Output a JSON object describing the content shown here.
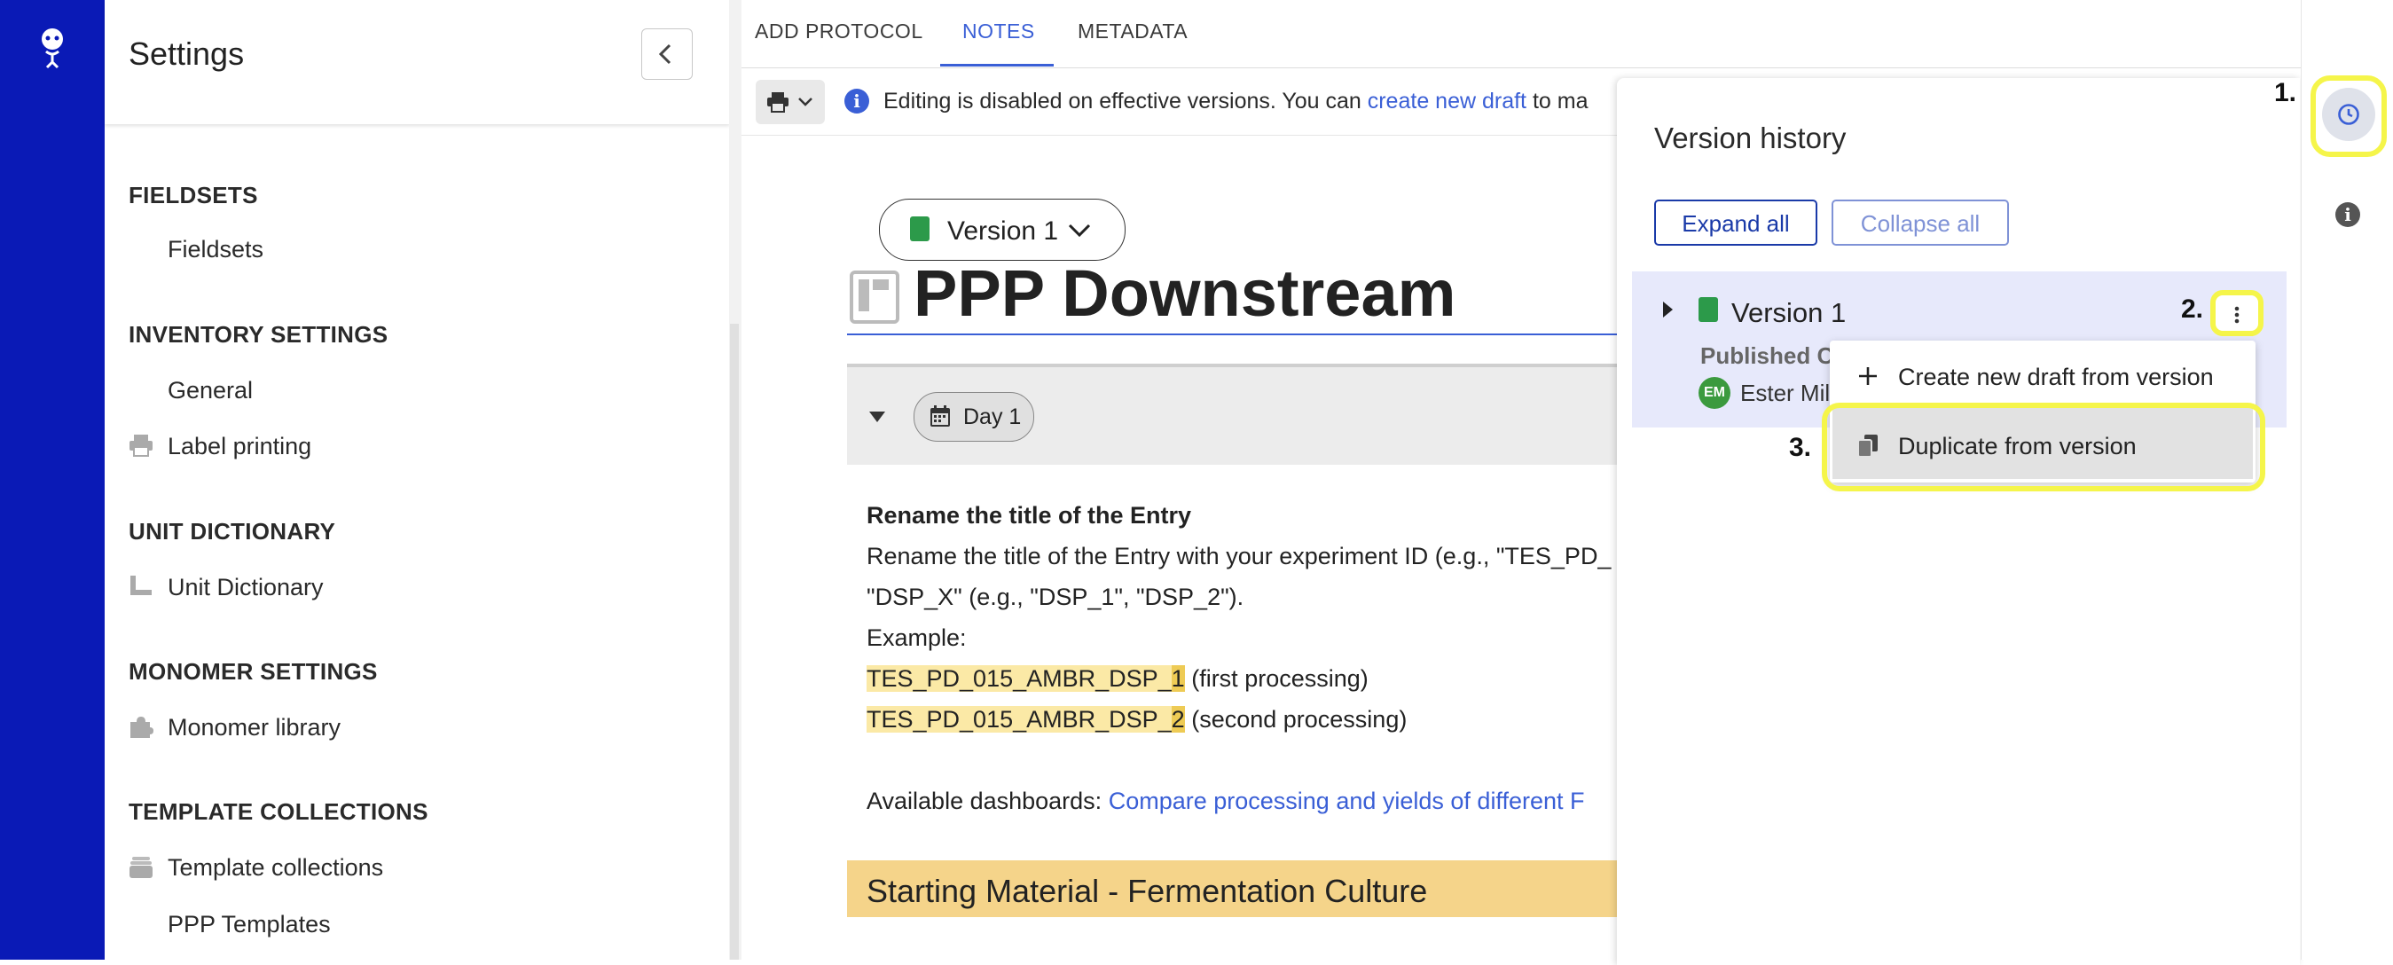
{
  "settings": {
    "title": "Settings",
    "sections": [
      {
        "heading": "FIELDSETS",
        "items": [
          {
            "label": "Fieldsets",
            "icon": null
          }
        ]
      },
      {
        "heading": "INVENTORY SETTINGS",
        "items": [
          {
            "label": "General",
            "icon": null
          },
          {
            "label": "Label printing",
            "icon": "printer-icon"
          }
        ]
      },
      {
        "heading": "UNIT DICTIONARY",
        "items": [
          {
            "label": "Unit Dictionary",
            "icon": "ruler-icon"
          }
        ]
      },
      {
        "heading": "MONOMER SETTINGS",
        "items": [
          {
            "label": "Monomer library",
            "icon": "puzzle-icon"
          }
        ]
      },
      {
        "heading": "TEMPLATE COLLECTIONS",
        "items": [
          {
            "label": "Template collections",
            "icon": "stack-icon"
          },
          {
            "label": "PPP Templates",
            "icon": null
          }
        ]
      }
    ]
  },
  "tabs": [
    {
      "label": "ADD PROTOCOL",
      "active": false
    },
    {
      "label": "NOTES",
      "active": true
    },
    {
      "label": "METADATA",
      "active": false
    }
  ],
  "toolbar": {
    "info_prefix": "Editing is disabled on effective versions. You can ",
    "info_link": "create new draft",
    "info_suffix": " to ma"
  },
  "document": {
    "version_label": "Version 1",
    "title": "PPP Downstream",
    "day_chip": "Day 1",
    "rename_heading": "Rename the title of the Entry",
    "rename_line1": "Rename the title of the Entry with your experiment ID (e.g., \"TES_PD_",
    "rename_line2": "\"DSP_X\" (e.g., \"DSP_1\", \"DSP_2\").",
    "example_label": "Example:",
    "example1_main": "TES_PD_015_AMBR_DSP_",
    "example1_num": "1",
    "example1_note": " (first processing)",
    "example2_main": "TES_PD_015_AMBR_DSP_",
    "example2_num": "2",
    "example2_note": " (second processing)",
    "dashboards_prefix": "Available dashboards: ",
    "dashboards_link": "Compare processing and yields of different F",
    "banner": "Starting Material - Fermentation Culture"
  },
  "version_history": {
    "title": "Version history",
    "expand_all": "Expand all",
    "collapse_all": "Collapse all",
    "version_name": "Version 1",
    "published": "Published C",
    "user_initials": "EM",
    "user_name": "Ester Mil",
    "menu": {
      "create_draft": "Create new draft from version",
      "duplicate": "Duplicate from version"
    }
  },
  "steps": {
    "one": "1.",
    "two": "2.",
    "three": "3."
  },
  "colors": {
    "rail": "#0a1ab6",
    "accent": "#3a5fd6",
    "highlight_annotation": "#f5f54a",
    "banner": "#f5d48a",
    "published_green": "#2c9a4a"
  }
}
